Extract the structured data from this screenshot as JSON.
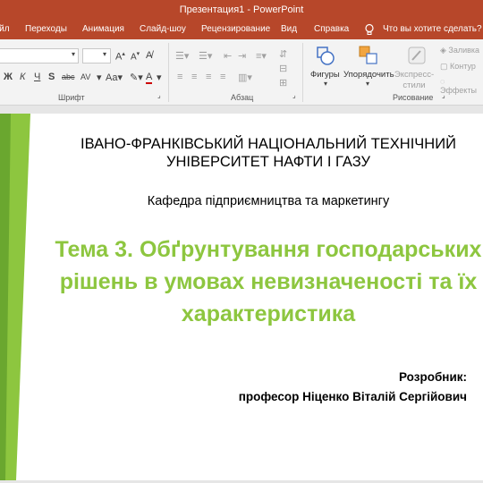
{
  "window": {
    "title": "Презентация1 - PowerPoint"
  },
  "tabs": [
    "Файл",
    "Переходы",
    "Анимация",
    "Слайд-шоу",
    "Рецензирование",
    "Вид",
    "Справка"
  ],
  "tell_me": "Что вы хотите сделать?",
  "ribbon": {
    "font_group": "Шрифт",
    "paragraph_group": "Абзац",
    "drawing_group": "Рисование",
    "shapes_label": "Фигуры",
    "arrange_label": "Упорядочить",
    "express_styles_label": "Экспресс-стили",
    "fill_label": "Заливка",
    "outline_label": "Контур",
    "effects_label": "Эффекты"
  },
  "slide": {
    "university": "ІВАНО-ФРАНКІВСЬКИЙ НАЦІОНАЛЬНИЙ ТЕХНІЧНИЙ УНІВЕРСИТЕТ НАФТИ І ГАЗУ",
    "department": "Кафедра підприємництва та маркетингу",
    "topic": "Тема 3. Обґрунтування господарських рішень в умовах невизначеності та їх характеристика",
    "author_label": "Розробник:",
    "author_name": "професор Ніценко Віталій Сергійович"
  },
  "colors": {
    "title_bar": "#b7472a",
    "accent_green": "#8dc63f",
    "dark_green": "#6aa72f"
  }
}
